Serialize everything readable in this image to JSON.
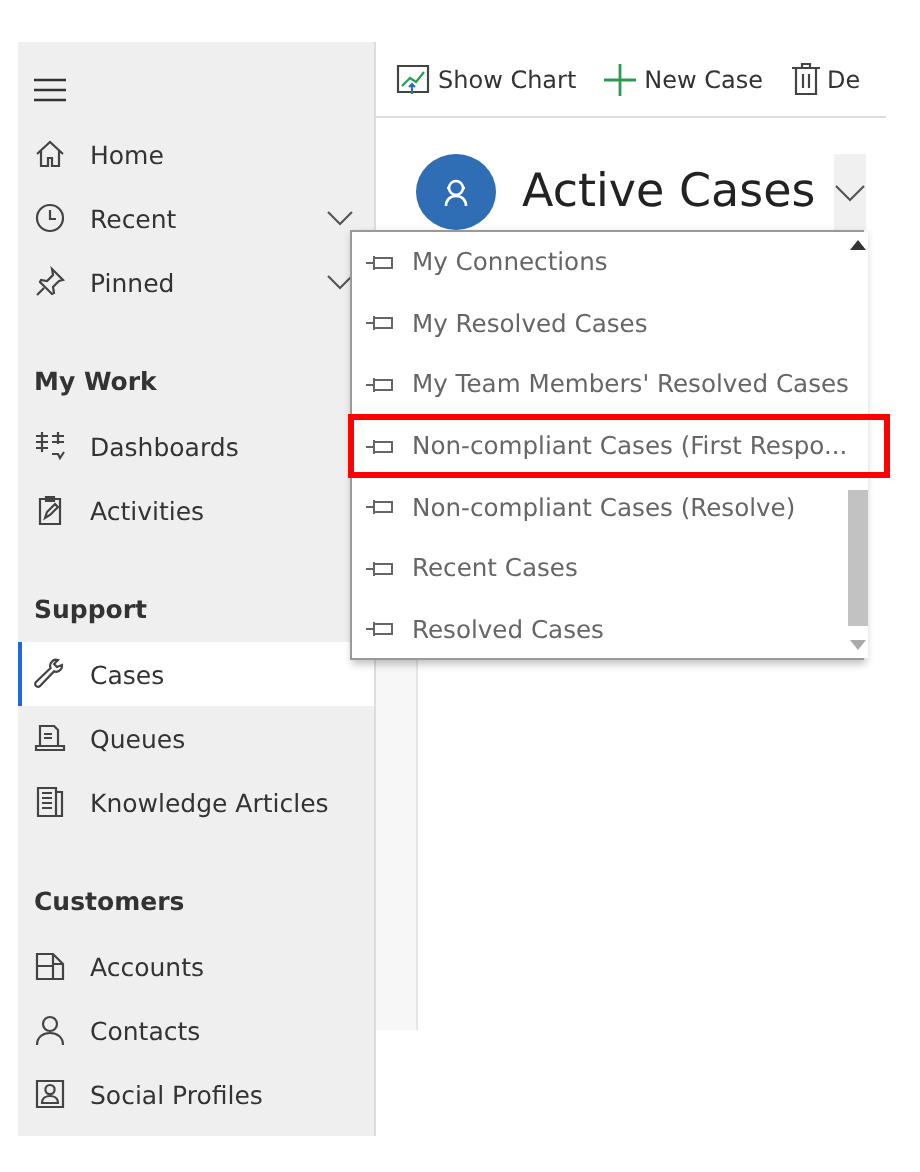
{
  "sidebar": {
    "top_items": [
      {
        "label": "Home",
        "expandable": false
      },
      {
        "label": "Recent",
        "expandable": true
      },
      {
        "label": "Pinned",
        "expandable": true
      }
    ],
    "sections": [
      {
        "heading": "My Work",
        "items": [
          {
            "label": "Dashboards",
            "selected": false
          },
          {
            "label": "Activities",
            "selected": false
          }
        ]
      },
      {
        "heading": "Support",
        "items": [
          {
            "label": "Cases",
            "selected": true
          },
          {
            "label": "Queues",
            "selected": false
          },
          {
            "label": "Knowledge Articles",
            "selected": false
          }
        ]
      },
      {
        "heading": "Customers",
        "items": [
          {
            "label": "Accounts",
            "selected": false
          },
          {
            "label": "Contacts",
            "selected": false
          },
          {
            "label": "Social Profiles",
            "selected": false
          }
        ]
      }
    ]
  },
  "toolbar": [
    "Show Chart",
    "New Case",
    "De"
  ],
  "view": {
    "title": "Active Cases"
  },
  "view_menu": [
    {
      "label": "My Connections",
      "highlighted": false
    },
    {
      "label": "My Resolved Cases",
      "highlighted": false
    },
    {
      "label": "My Team Members' Resolved Cases",
      "highlighted": false
    },
    {
      "label": "Non-compliant Cases (First Respo...",
      "highlighted": true
    },
    {
      "label": "Non-compliant Cases (Resolve)",
      "highlighted": false
    },
    {
      "label": "Recent Cases",
      "highlighted": false
    },
    {
      "label": "Resolved Cases",
      "highlighted": false
    }
  ]
}
